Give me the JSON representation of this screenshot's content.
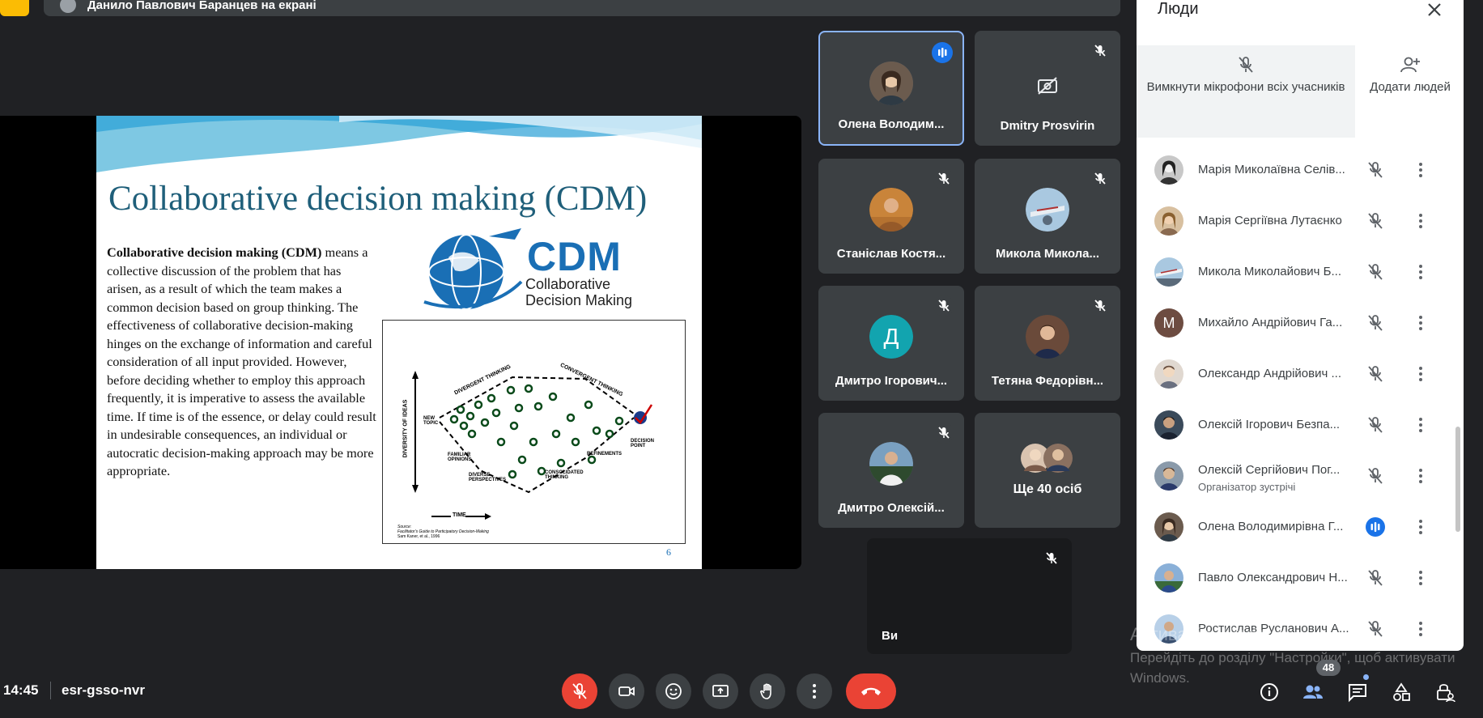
{
  "presenter_banner": "Данило Павлович Баранцев на екрані",
  "slide": {
    "title": "Collaborative decision making (CDM)",
    "body_bold": "Collaborative decision making (CDM)",
    "body_text": "means a collective discussion of the problem that has arisen, as a result of which the team makes a common decision based on group thinking. The effectiveness of collaborative decision-making hinges on the exchange of information and careful consideration of all input provided. However, before deciding whether to employ this approach frequently, it is imperative to assess the available time. If time is of the essence, or delay could result in undesirable consequences, an individual or autocratic decision-making approach may be more appropriate.",
    "logo_big": "CDM",
    "logo_line1": "Collaborative",
    "logo_line2": "Decision Making",
    "diagram": {
      "divergent": "DIVERGENT THINKING",
      "convergent": "CONVERGENT THINKING",
      "new_topic": "NEW TOPIC",
      "familiar": "FAMILIAR OPINIONS",
      "diverse": "DIVERSE PERSPECTIVES",
      "consolidated": "CONSOLIDATED THINKING",
      "refinements": "REFINEMENTS",
      "decision": "DECISION POINT",
      "y_axis": "DIVERSITY OF IDEAS",
      "x_axis": "TIME",
      "source1": "Source:",
      "source2": "Facilitator's Guide to Participatory Decision-Making",
      "source3": "Sam Kaner, et al., 1996"
    },
    "page_number": "6"
  },
  "tiles": [
    {
      "name": "Олена Володим...",
      "speaking": true
    },
    {
      "name": "Dmitry Prosvirin",
      "camera_off": true
    },
    {
      "name": "Станіслав Костя..."
    },
    {
      "name": "Микола Микола..."
    },
    {
      "name": "Дмитро Ігорович...",
      "letter": "Д",
      "color": "#12a4af"
    },
    {
      "name": "Тетяна Федорівн..."
    },
    {
      "name": "Дмитро Олексій..."
    },
    {
      "name": "Ще 40 осіб"
    }
  ],
  "self_tile": {
    "name": "Ви"
  },
  "panel": {
    "title": "Люди",
    "mute_all": "Вимкнути мікрофони всіх учасників",
    "add_people": "Додати людей",
    "participants": [
      {
        "name": "Марія Миколаївна Селів...",
        "role": ""
      },
      {
        "name": "Марія Сергіївна Лутаєнко",
        "role": ""
      },
      {
        "name": "Микола Миколайович Б...",
        "role": ""
      },
      {
        "name": "Михайло Андрійович Га...",
        "role": "",
        "letter": "M"
      },
      {
        "name": "Олександр Андрійович ...",
        "role": ""
      },
      {
        "name": "Олексій Ігорович Безпа...",
        "role": ""
      },
      {
        "name": "Олексій Сергійович Пог...",
        "role": "Організатор зустрічі"
      },
      {
        "name": "Олена Володимирівна Г...",
        "role": "",
        "speaking": true
      },
      {
        "name": "Павло Олександрович Н...",
        "role": ""
      },
      {
        "name": "Ростислав Русланович А...",
        "role": ""
      }
    ]
  },
  "bottom": {
    "time": "14:45",
    "meeting_code": "esr-gsso-nvr",
    "people_count": "48"
  },
  "windows_activation": {
    "line1": "Активація Windows",
    "line2": "Перейдіть до розділу \"Настройки\", щоб активувати",
    "line3": "Windows."
  },
  "colors": {
    "accent": "#8ab4f8",
    "danger": "#ea4335",
    "speaking": "#1a73e8",
    "background": "#202124"
  }
}
